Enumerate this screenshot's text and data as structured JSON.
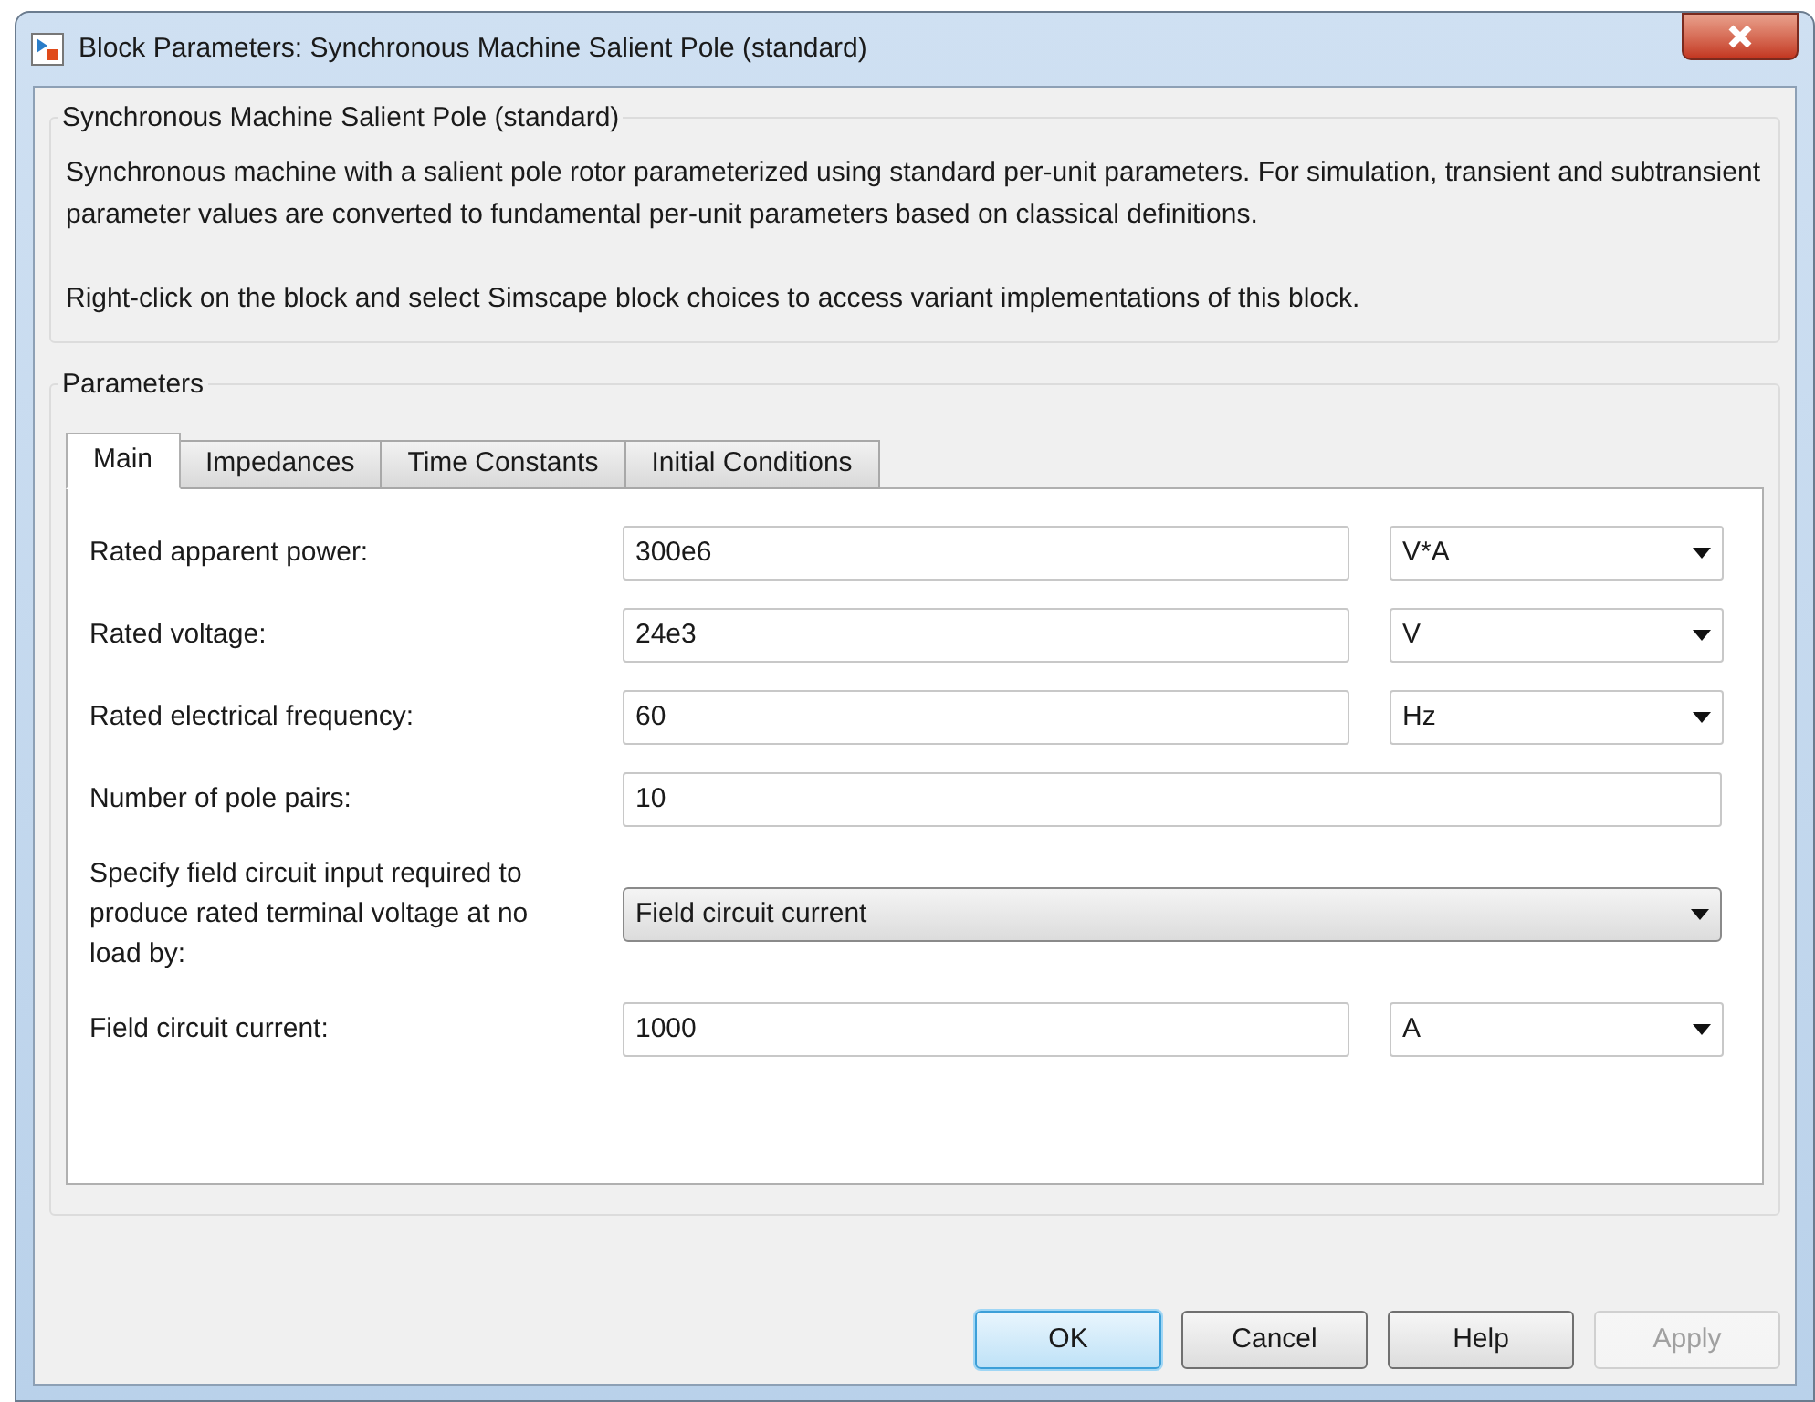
{
  "window": {
    "title": "Block Parameters: Synchronous Machine Salient Pole (standard)"
  },
  "description": {
    "title": "Synchronous Machine Salient Pole (standard)",
    "paragraphs": [
      "Synchronous machine with a salient pole rotor parameterized using standard per-unit parameters. For simulation, transient and subtransient parameter values are converted to fundamental per-unit parameters based on classical definitions.",
      "Right-click on the block and select Simscape block choices to access variant implementations of this block."
    ]
  },
  "parameters": {
    "title": "Parameters",
    "tabs": [
      {
        "label": "Main",
        "selected": true
      },
      {
        "label": "Impedances",
        "selected": false
      },
      {
        "label": "Time Constants",
        "selected": false
      },
      {
        "label": "Initial Conditions",
        "selected": false
      }
    ],
    "rows": [
      {
        "kind": "value_unit",
        "label": "Rated apparent power:",
        "value": "300e6",
        "unit": "V*A"
      },
      {
        "kind": "value_unit",
        "label": "Rated voltage:",
        "value": "24e3",
        "unit": "V"
      },
      {
        "kind": "value_unit",
        "label": "Rated electrical frequency:",
        "value": "60",
        "unit": "Hz"
      },
      {
        "kind": "value",
        "label": "Number of pole pairs:",
        "value": "10"
      },
      {
        "kind": "dropdown",
        "label": "Specify field circuit input required to produce rated terminal voltage at no load by:",
        "value": "Field circuit current"
      },
      {
        "kind": "value_unit",
        "label": "Field circuit current:",
        "value": "1000",
        "unit": "A"
      }
    ]
  },
  "buttons": [
    {
      "label": "OK",
      "default": true,
      "disabled": false
    },
    {
      "label": "Cancel",
      "default": false,
      "disabled": false
    },
    {
      "label": "Help",
      "default": false,
      "disabled": false
    },
    {
      "label": "Apply",
      "default": false,
      "disabled": true
    }
  ]
}
